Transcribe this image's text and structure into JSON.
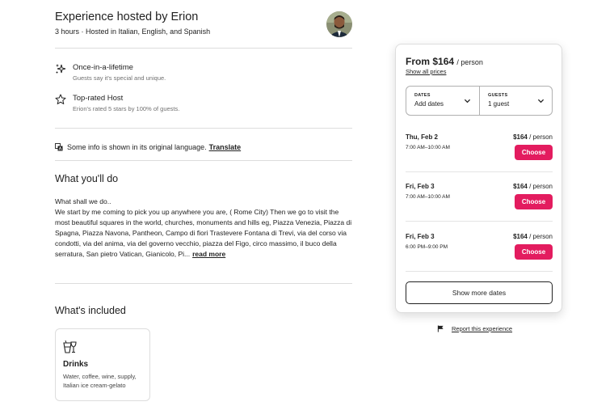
{
  "host": {
    "title": "Experience hosted by Erion",
    "subtitle": "3 hours · Hosted in Italian, English, and Spanish",
    "avatar_icon": "host-avatar"
  },
  "highlights": [
    {
      "icon": "sparkle-icon",
      "title": "Once-in-a-lifetime",
      "desc": "Guests say it's special and unique."
    },
    {
      "icon": "star-icon",
      "title": "Top-rated Host",
      "desc": "Erion's rated 5 stars by 100% of guests."
    }
  ],
  "translate": {
    "text": "Some info is shown in its original language.",
    "link": "Translate"
  },
  "what_you_do": {
    "heading": "What you'll do",
    "line1": "What shall we do..",
    "body": "We start by me coming to pick you up anywhere you are, ( Rome City) Then we go to visit the most beautiful squares in the world, churches, monuments and hills eg, Piazza Venezia, Piazza di Spagna, Piazza Navona, Pantheon, Campo di fiori Trastevere Fontana di Trevi, via del corso via condotti, via del anima, via del governo vecchio, piazza del Figo, circo massimo, il buco della serratura, San pietro Vatican, Gianicolo, Pi...",
    "read_more": "read more"
  },
  "whats_included": {
    "heading": "What's included",
    "items": [
      {
        "icon": "drinks-icon",
        "title": "Drinks",
        "desc": "Water, coffee, wine, supply, Italian ice cream-gelato"
      }
    ]
  },
  "booking": {
    "price_prefix": "From",
    "price": "$164",
    "per": "/ person",
    "show_all_prices": "Show all prices",
    "dates_label": "DATES",
    "dates_value": "Add dates",
    "guests_label": "GUESTS",
    "guests_value": "1 guest",
    "slots": [
      {
        "date": "Thu, Feb 2",
        "time": "7:00 AM–10:00 AM",
        "price": "$164",
        "per": "/ person",
        "button": "Choose"
      },
      {
        "date": "Fri, Feb 3",
        "time": "7:00 AM–10:00 AM",
        "price": "$164",
        "per": "/ person",
        "button": "Choose"
      },
      {
        "date": "Fri, Feb 3",
        "time": "6:00 PM–9:00 PM",
        "price": "$164",
        "per": "/ person",
        "button": "Choose"
      }
    ],
    "show_more": "Show more dates"
  },
  "report": {
    "text": "Report this experience",
    "icon": "flag-icon"
  },
  "colors": {
    "accent": "#e31c5f",
    "text": "#222222",
    "muted": "#717171",
    "border": "#dddddd"
  }
}
